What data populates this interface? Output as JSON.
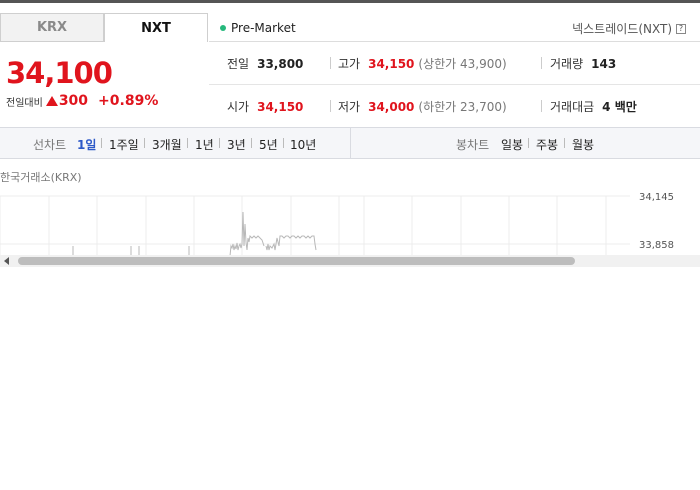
{
  "tabs": [
    {
      "label": "KRX",
      "active": false
    },
    {
      "label": "NXT",
      "active": true
    }
  ],
  "session": {
    "label": "Pre-Market",
    "color": "#26b87c"
  },
  "nxt_link": {
    "label": "넥스트레이드(NXT)",
    "help_icon": "?"
  },
  "quote": {
    "price": "34,100",
    "change_label": "전일대비",
    "change_value": "300",
    "change_pct": "+0.89%",
    "direction_icon": "up-triangle-icon",
    "up_color": "#e0141d"
  },
  "stats": {
    "prev_close": {
      "label": "전일",
      "value": "33,800"
    },
    "high": {
      "label": "고가",
      "value": "34,150",
      "sub": "(상한가 43,900)"
    },
    "volume": {
      "label": "거래량",
      "value": "143"
    },
    "open": {
      "label": "시가",
      "value": "34,150"
    },
    "low": {
      "label": "저가",
      "value": "34,000",
      "sub": "(하한가 23,700)"
    },
    "amount": {
      "label": "거래대금",
      "value": "4 백만"
    }
  },
  "toolbar": {
    "line_chart_label": "선차트",
    "periods": [
      "1일",
      "1주일",
      "3개월",
      "1년",
      "3년",
      "5년",
      "10년"
    ],
    "selected_period": "1일",
    "candle_chart_label": "봉차트",
    "candle_periods": [
      "일봉",
      "주봉",
      "월봉"
    ]
  },
  "chart_source": "한국거래소(KRX)",
  "chart_data": {
    "type": "line",
    "title": "",
    "y_ticks": [
      "34,145",
      "33,858"
    ],
    "ylim": [
      33858,
      34145
    ],
    "grid": true
  }
}
